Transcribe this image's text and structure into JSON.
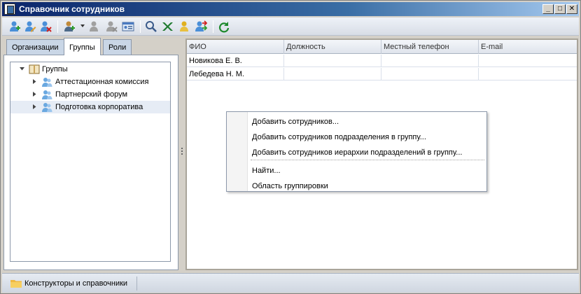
{
  "window": {
    "title": "Справочник сотрудников",
    "controls": {
      "minimize": "_",
      "maximize": "□",
      "close": "✕"
    }
  },
  "toolbar": {
    "buttons": [
      {
        "name": "add-employee-icon"
      },
      {
        "name": "edit-employee-icon"
      },
      {
        "name": "delete-employee-icon"
      },
      {
        "name": "add-user-dropdown-icon"
      },
      {
        "name": "user-disabled-icon"
      },
      {
        "name": "user-remove-disabled-icon"
      },
      {
        "name": "card-icon"
      },
      {
        "name": "search-icon"
      },
      {
        "name": "excel-export-icon"
      },
      {
        "name": "user-badge-icon"
      },
      {
        "name": "transfer-icon"
      },
      {
        "name": "refresh-icon"
      }
    ]
  },
  "tabs": [
    {
      "label": "Организации",
      "active": false
    },
    {
      "label": "Группы",
      "active": true
    },
    {
      "label": "Роли",
      "active": false
    }
  ],
  "tree": {
    "root": "Группы",
    "items": [
      "Аттестационная комиссия",
      "Партнерский форум",
      "Подготовка корпоратива"
    ],
    "selected_index": 2
  },
  "grid": {
    "columns": [
      "ФИО",
      "Должность",
      "Местный телефон",
      "E-mail"
    ],
    "rows": [
      [
        "Новикова Е. В.",
        "",
        "",
        ""
      ],
      [
        "Лебедева Н. М.",
        "",
        "",
        ""
      ]
    ]
  },
  "context_menu": {
    "items": [
      "Добавить сотрудников...",
      "Добавить сотрудников подразделения в группу...",
      "Добавить сотрудников иерархии подразделений в группу...",
      "Найти...",
      "Область группировки"
    ]
  },
  "bottombar": {
    "task_label": "Конструкторы и справочники"
  },
  "colors": {
    "title_bar": "#0a246a",
    "selection": "#e6ecf5",
    "tab_inactive": "#c9d6e6"
  }
}
